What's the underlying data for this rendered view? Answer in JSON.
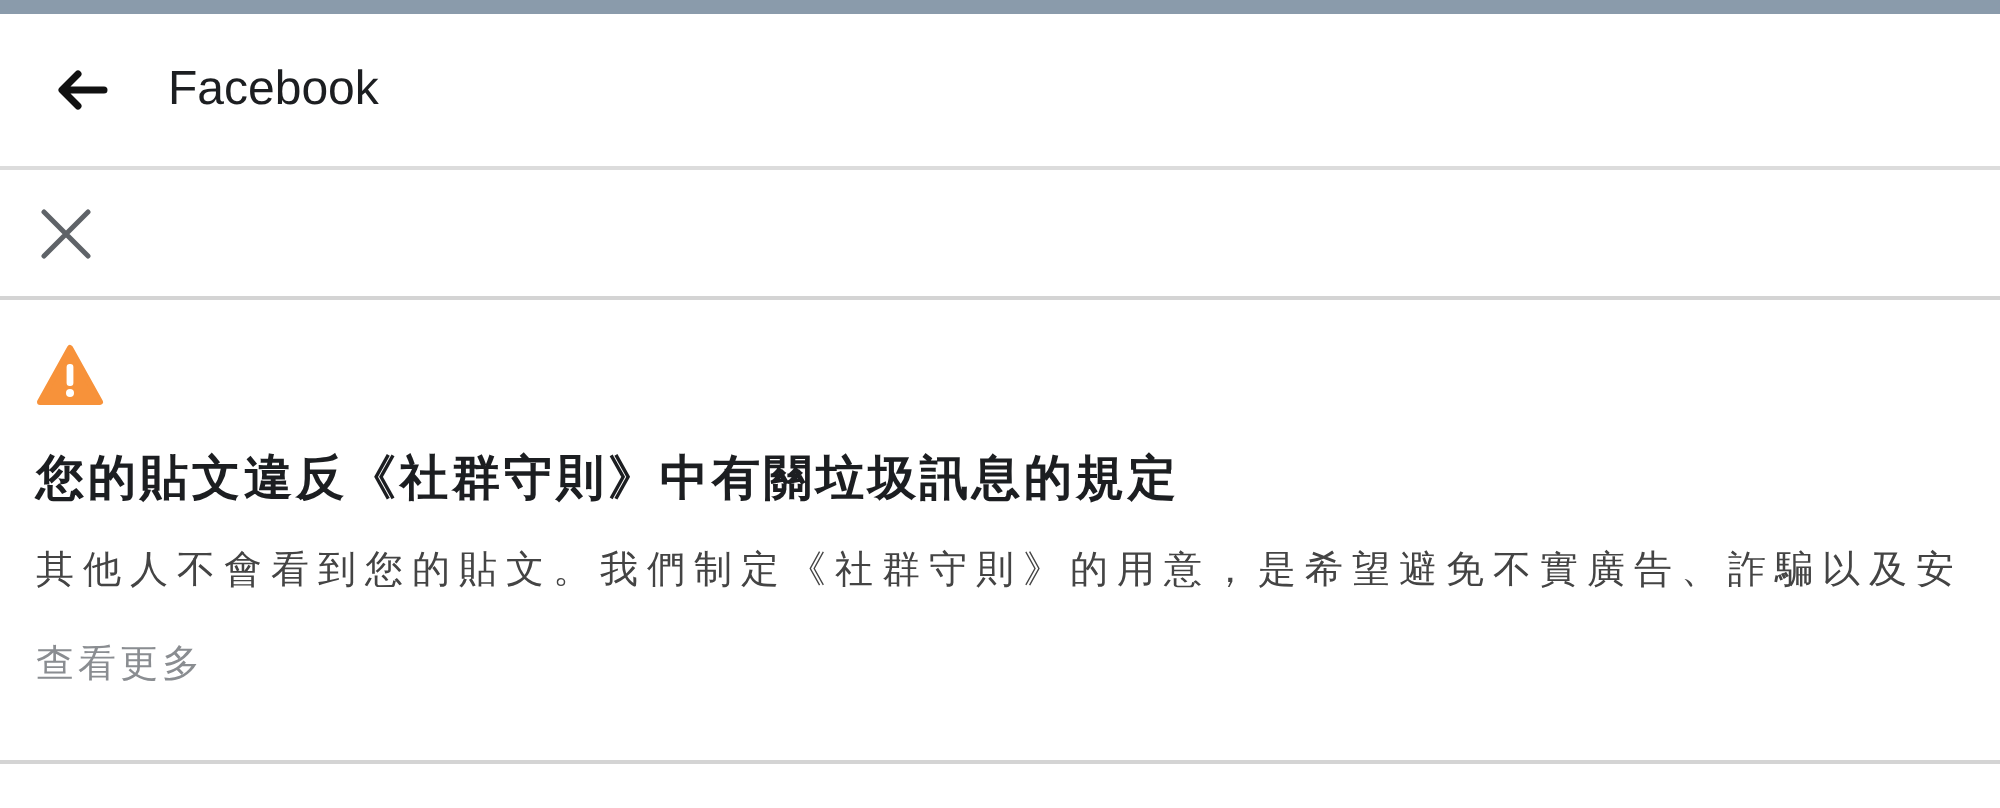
{
  "header": {
    "title": "Facebook"
  },
  "notice": {
    "heading": "您的貼文違反《社群守則》中有關垃圾訊息的規定",
    "body": "其他人不會看到您的貼文。我們制定《社群守則》的用意，是希望避免不實廣告、詐騙以及安",
    "see_more": "查看更多"
  }
}
